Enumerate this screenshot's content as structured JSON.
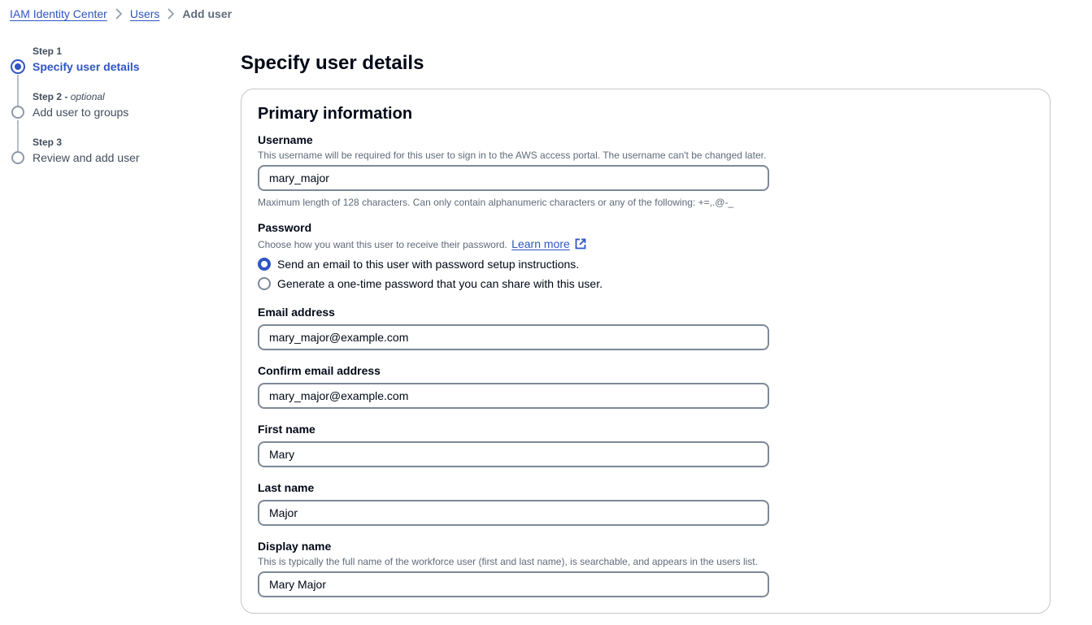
{
  "breadcrumb": [
    {
      "label": "IAM Identity Center",
      "link": true
    },
    {
      "label": "Users",
      "link": true
    },
    {
      "label": "Add user",
      "link": false
    }
  ],
  "steps": [
    {
      "number": "Step 1",
      "optional": "",
      "title": "Specify user details",
      "active": true
    },
    {
      "number": "Step 2",
      "optional": "optional",
      "title": "Add user to groups",
      "active": false
    },
    {
      "number": "Step 3",
      "optional": "",
      "title": "Review and add user",
      "active": false
    }
  ],
  "page_title": "Specify user details",
  "section_title": "Primary information",
  "username": {
    "label": "Username",
    "description": "This username will be required for this user to sign in to the AWS access portal. The username can't be changed later.",
    "value": "mary_major",
    "constraint": "Maximum length of 128 characters. Can only contain alphanumeric characters or any of the following: +=,.@-_"
  },
  "password": {
    "label": "Password",
    "description": "Choose how you want this user to receive their password.",
    "learn_more": "Learn more",
    "options": [
      {
        "label": "Send an email to this user with password setup instructions.",
        "checked": true
      },
      {
        "label": "Generate a one-time password that you can share with this user.",
        "checked": false
      }
    ]
  },
  "email": {
    "label": "Email address",
    "value": "mary_major@example.com"
  },
  "confirm_email": {
    "label": "Confirm email address",
    "value": "mary_major@example.com"
  },
  "first_name": {
    "label": "First name",
    "value": "Mary"
  },
  "last_name": {
    "label": "Last name",
    "value": "Major"
  },
  "display_name": {
    "label": "Display name",
    "description": "This is typically the full name of the workforce user (first and last name), is searchable, and appears in the users list.",
    "value": "Mary Major"
  },
  "colors": {
    "accent": "#2f55c4",
    "text": "#000716",
    "muted": "#5f6b7a",
    "border": "#7d8998"
  }
}
